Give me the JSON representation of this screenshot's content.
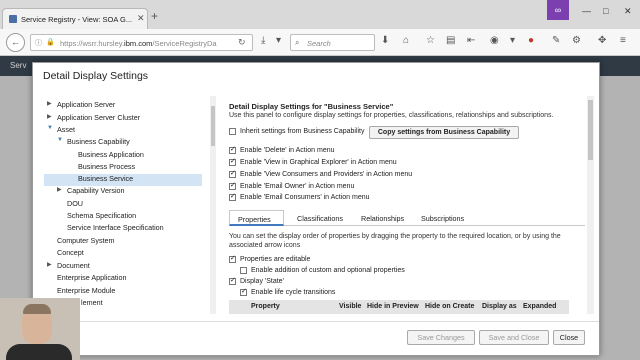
{
  "browser": {
    "tab_title": "Service Registry - View: SOA G...",
    "url_scheme": "https://wsrr.hursley.",
    "url_domain": "ibm.com",
    "url_path": "/ServiceRegistryDa",
    "search_placeholder": "Search",
    "accent": "#7b3fb0"
  },
  "app": {
    "topbar_text": "Serv"
  },
  "modal": {
    "title": "Detail Display Settings",
    "tree": [
      {
        "label": "Application Server",
        "level": 0,
        "arrow": "right"
      },
      {
        "label": "Application Server Cluster",
        "level": 0,
        "arrow": "right"
      },
      {
        "label": "Asset",
        "level": 0,
        "arrow": "down"
      },
      {
        "label": "Business Capability",
        "level": 1,
        "arrow": "down"
      },
      {
        "label": "Business Application",
        "level": 2,
        "arrow": ""
      },
      {
        "label": "Business Process",
        "level": 2,
        "arrow": ""
      },
      {
        "label": "Business Service",
        "level": 2,
        "arrow": "",
        "selected": true
      },
      {
        "label": "Capability Version",
        "level": 1,
        "arrow": "right"
      },
      {
        "label": "DOU",
        "level": 1,
        "arrow": ""
      },
      {
        "label": "Schema Specification",
        "level": 1,
        "arrow": ""
      },
      {
        "label": "Service Interface Specification",
        "level": 1,
        "arrow": ""
      },
      {
        "label": "Computer System",
        "level": 0,
        "arrow": ""
      },
      {
        "label": "Concept",
        "level": 0,
        "arrow": ""
      },
      {
        "label": "Document",
        "level": 0,
        "arrow": "right"
      },
      {
        "label": "Enterprise Application",
        "level": 0,
        "arrow": ""
      },
      {
        "label": "Enterprise Module",
        "level": 0,
        "arrow": ""
      },
      {
        "label": "lement",
        "level": 0,
        "arrow": ""
      }
    ],
    "heading": "Detail Display Settings for \"Business Service\"",
    "description": "Use this panel to configure display settings for properties, classifications, relationships and subscriptions.",
    "inherit_label": "Inherit settings from Business Capability",
    "copy_button": "Copy settings from Business Capability",
    "actions": [
      {
        "label": "Enable 'Delete' in Action menu",
        "checked": true
      },
      {
        "label": "Enable 'View in Graphical Explorer' in Action menu",
        "checked": true
      },
      {
        "label": "Enable 'View Consumers and Providers' in Action menu",
        "checked": true
      },
      {
        "label": "Enable 'Email Owner' in Action menu",
        "checked": true
      },
      {
        "label": "Enable 'Email Consumers' in Action menu",
        "checked": true
      }
    ],
    "tabs": [
      "Properties",
      "Classifications",
      "Relationships",
      "Subscriptions"
    ],
    "properties_text": "You can set the display order of properties by dragging the property to the required location, or by using the associated arrow icons",
    "editable_label": "Properties are editable",
    "custom_label": "Enable addition of custom and optional properties",
    "display_state_label": "Display 'State'",
    "lifecycle_label": "Enable life cycle transitions",
    "columns": [
      "Property",
      "Visible",
      "Hide in Preview",
      "Hide on Create",
      "Display as",
      "Expanded"
    ],
    "footer": {
      "save": "Save Changes",
      "save_close": "Save and Close",
      "close": "Close"
    }
  }
}
